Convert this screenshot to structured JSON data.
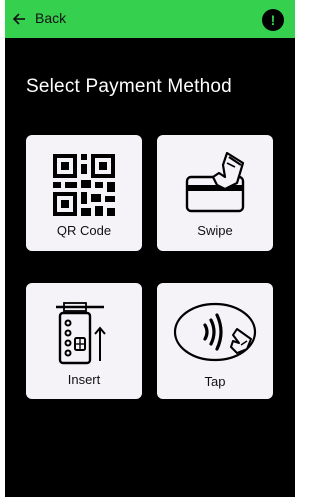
{
  "header": {
    "back_label": "Back",
    "alert_symbol": "!",
    "back_icon": "arrow-left-icon",
    "alert_icon": "alert-circle-icon",
    "bar_color": "#36d04f"
  },
  "page": {
    "title": "Select Payment Method"
  },
  "options": [
    {
      "label": "QR Code",
      "icon": "qr-code-icon"
    },
    {
      "label": "Swipe",
      "icon": "card-swipe-icon"
    },
    {
      "label": "Insert",
      "icon": "card-insert-icon"
    },
    {
      "label": "Tap",
      "icon": "contactless-tap-icon"
    }
  ],
  "colors": {
    "background": "#000000",
    "card": "#f6f3f8",
    "text_on_dark": "#ffffff"
  }
}
